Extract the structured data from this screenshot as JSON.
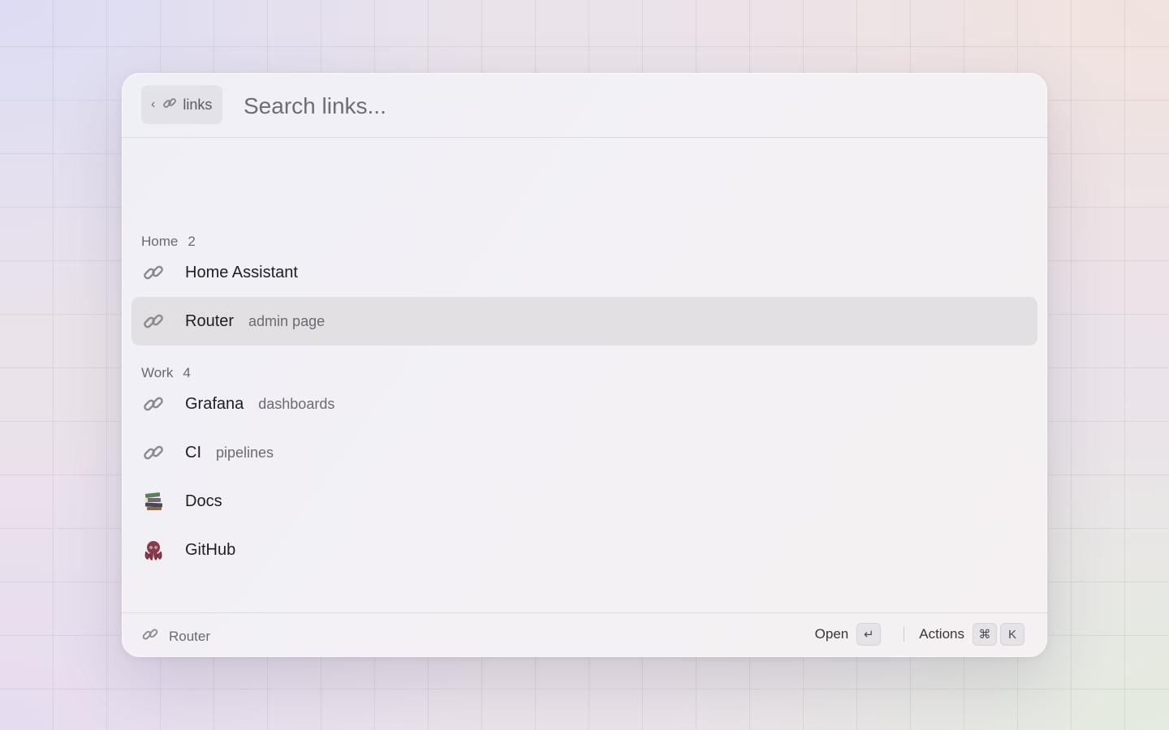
{
  "search": {
    "scope_label": "links",
    "placeholder": "Search links..."
  },
  "sections": [
    {
      "name": "Home",
      "count": "2",
      "items": [
        {
          "title": "Home Assistant",
          "subtitle": "",
          "icon": "link-icon"
        },
        {
          "title": "Router",
          "subtitle": "admin page",
          "icon": "link-icon",
          "selected": true
        }
      ]
    },
    {
      "name": "Work",
      "count": "4",
      "items": [
        {
          "title": "Grafana",
          "subtitle": "dashboards",
          "icon": "link-icon"
        },
        {
          "title": "CI",
          "subtitle": "pipelines",
          "icon": "link-icon"
        },
        {
          "title": "Docs",
          "subtitle": "",
          "icon": "books-icon"
        },
        {
          "title": "GitHub",
          "subtitle": "",
          "icon": "octopus-icon"
        }
      ]
    }
  ],
  "footer": {
    "current_item": "Router",
    "open_label": "Open",
    "open_key": "↵",
    "actions_label": "Actions",
    "actions_keys": [
      "⌘",
      "K"
    ]
  },
  "colors": {
    "selected_row": "#e3e0e3",
    "panel_bg": "#f3f1f5",
    "text_primary": "#1f1d22",
    "text_secondary": "#6c6972"
  }
}
